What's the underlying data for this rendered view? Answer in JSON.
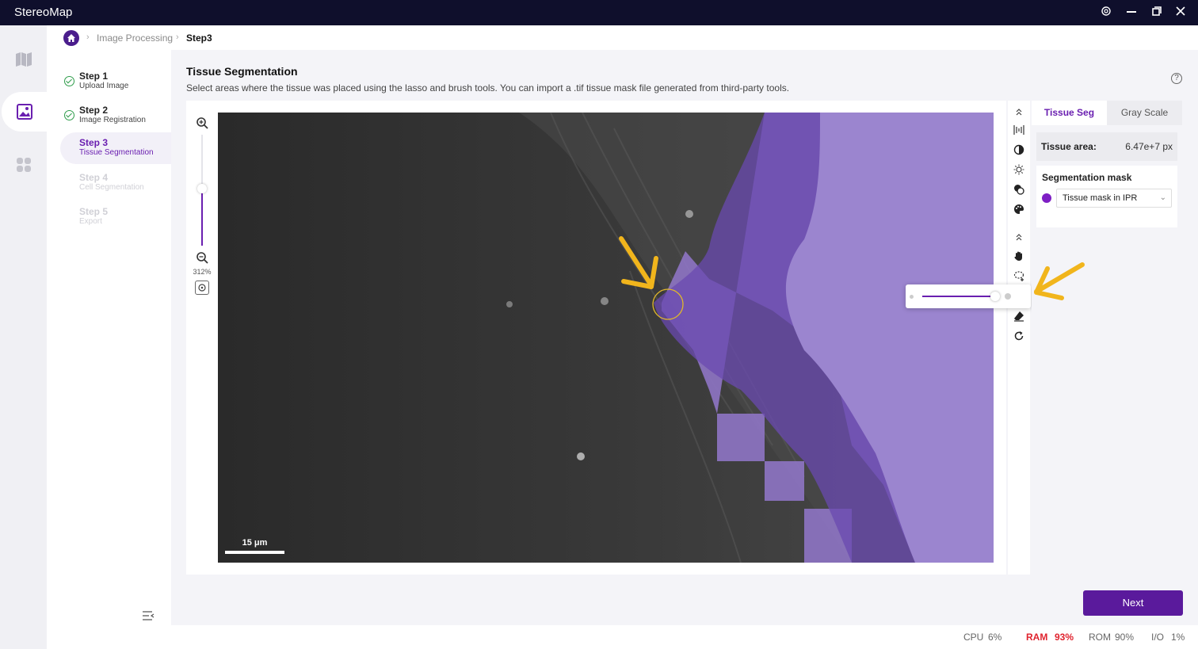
{
  "app": {
    "title": "StereoMap"
  },
  "window_controls": {
    "settings_icon": "gear-icon",
    "minimize_icon": "minimize-icon",
    "restore_icon": "restore-icon",
    "close_icon": "close-icon"
  },
  "breadcrumb": {
    "home_icon": "home-icon",
    "items": [
      "Image Processing",
      "Step3"
    ]
  },
  "steps": [
    {
      "title": "Step 1",
      "sub": "Upload Image",
      "state": "done"
    },
    {
      "title": "Step 2",
      "sub": "Image Registration",
      "state": "done"
    },
    {
      "title": "Step 3",
      "sub": "Tissue Segmentation",
      "state": "active"
    },
    {
      "title": "Step 4",
      "sub": "Cell Segmentation",
      "state": "disabled"
    },
    {
      "title": "Step 5",
      "sub": "Export",
      "state": "disabled"
    }
  ],
  "page": {
    "title": "Tissue Segmentation",
    "description": "Select areas where the tissue was placed using the lasso and brush tools. You can import a .tif tissue mask file generated from third-party tools."
  },
  "viewer": {
    "zoom": "312%",
    "scale_bar": "15 μm",
    "mask_color": "#8e74c4"
  },
  "tools": [
    "collapse-up-icon",
    "align-icon",
    "contrast-icon",
    "brightness-icon",
    "overlay-icon",
    "palette-icon",
    "collapse-up-icon",
    "hand-icon",
    "lasso-add-icon",
    "brush-icon",
    "eraser-icon",
    "redo-icon"
  ],
  "side_panel": {
    "tabs": [
      "Tissue Seg",
      "Gray Scale"
    ],
    "tissue_area_label": "Tissue area:",
    "tissue_area_value": "6.47e+7 px",
    "mask_label": "Segmentation mask",
    "mask_select": "Tissue mask in IPR"
  },
  "actions": {
    "next": "Next"
  },
  "status": {
    "cpu_label": "CPU",
    "cpu_value": "6%",
    "ram_label": "RAM",
    "ram_value": "93%",
    "rom_label": "ROM",
    "rom_value": "90%",
    "io_label": "I/O",
    "io_value": "1%"
  },
  "colors": {
    "accent": "#6a1fb0",
    "titlebar": "#0f0f2c",
    "annotation": "#f1b51c",
    "warning": "#e0232e"
  }
}
